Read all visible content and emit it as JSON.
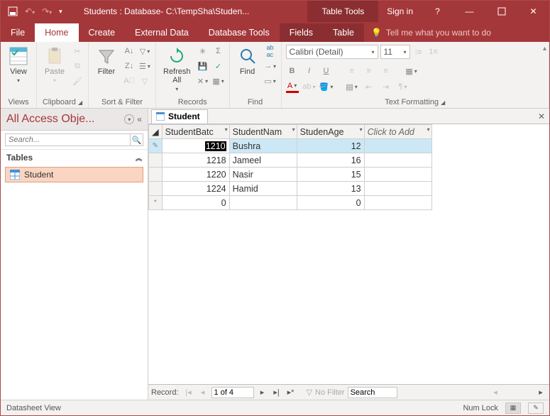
{
  "titlebar": {
    "title": "Students : Database- C:\\TempSha\\Studen...",
    "context_tool": "Table Tools",
    "signin": "Sign in"
  },
  "menutabs": {
    "file": "File",
    "home": "Home",
    "create": "Create",
    "external": "External Data",
    "dbtools": "Database Tools",
    "fields": "Fields",
    "table": "Table",
    "tellme": "Tell me what you want to do"
  },
  "ribbon": {
    "views": {
      "view": "View",
      "group": "Views"
    },
    "clipboard": {
      "paste": "Paste",
      "group": "Clipboard"
    },
    "sortfilter": {
      "filter": "Filter",
      "group": "Sort & Filter"
    },
    "records": {
      "refresh": "Refresh\nAll",
      "group": "Records"
    },
    "find": {
      "find": "Find",
      "group": "Find"
    },
    "textfmt": {
      "group": "Text Formatting",
      "font_name": "Calibri (Detail)",
      "font_size": "11"
    }
  },
  "nav": {
    "header": "All Access Obje...",
    "search_placeholder": "Search...",
    "group_tables": "Tables",
    "items": [
      {
        "label": "Student"
      }
    ]
  },
  "datasheet": {
    "tab_label": "Student",
    "columns": [
      "StudentBatc",
      "StudentNam",
      "StudenAge",
      "Click to Add"
    ],
    "rows": [
      {
        "batch": "1210",
        "name": "Bushra",
        "age": "12",
        "selected": true,
        "editing": true
      },
      {
        "batch": "1218",
        "name": "Jameel",
        "age": "16"
      },
      {
        "batch": "1220",
        "name": "Nasir",
        "age": "15"
      },
      {
        "batch": "1224",
        "name": "Hamid",
        "age": "13"
      }
    ],
    "newrow": {
      "batch": "0",
      "age": "0"
    }
  },
  "recnav": {
    "label": "Record:",
    "pos": "1 of 4",
    "nofilter": "No Filter",
    "search": "Search"
  },
  "status": {
    "left": "Datasheet View",
    "numlock": "Num Lock"
  }
}
